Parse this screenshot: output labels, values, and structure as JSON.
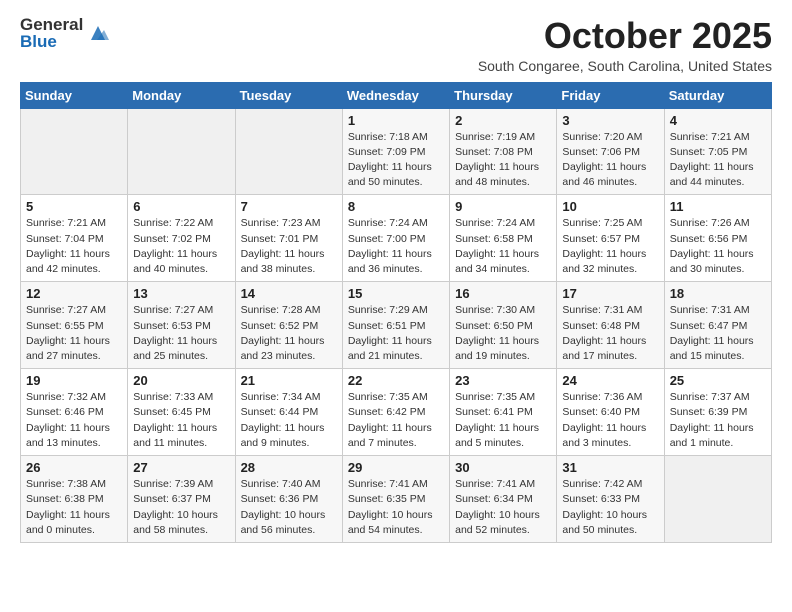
{
  "logo": {
    "general": "General",
    "blue": "Blue"
  },
  "header": {
    "month": "October 2025",
    "location": "South Congaree, South Carolina, United States"
  },
  "days_of_week": [
    "Sunday",
    "Monday",
    "Tuesday",
    "Wednesday",
    "Thursday",
    "Friday",
    "Saturday"
  ],
  "weeks": [
    [
      {
        "day": "",
        "info": ""
      },
      {
        "day": "",
        "info": ""
      },
      {
        "day": "",
        "info": ""
      },
      {
        "day": "1",
        "info": "Sunrise: 7:18 AM\nSunset: 7:09 PM\nDaylight: 11 hours\nand 50 minutes."
      },
      {
        "day": "2",
        "info": "Sunrise: 7:19 AM\nSunset: 7:08 PM\nDaylight: 11 hours\nand 48 minutes."
      },
      {
        "day": "3",
        "info": "Sunrise: 7:20 AM\nSunset: 7:06 PM\nDaylight: 11 hours\nand 46 minutes."
      },
      {
        "day": "4",
        "info": "Sunrise: 7:21 AM\nSunset: 7:05 PM\nDaylight: 11 hours\nand 44 minutes."
      }
    ],
    [
      {
        "day": "5",
        "info": "Sunrise: 7:21 AM\nSunset: 7:04 PM\nDaylight: 11 hours\nand 42 minutes."
      },
      {
        "day": "6",
        "info": "Sunrise: 7:22 AM\nSunset: 7:02 PM\nDaylight: 11 hours\nand 40 minutes."
      },
      {
        "day": "7",
        "info": "Sunrise: 7:23 AM\nSunset: 7:01 PM\nDaylight: 11 hours\nand 38 minutes."
      },
      {
        "day": "8",
        "info": "Sunrise: 7:24 AM\nSunset: 7:00 PM\nDaylight: 11 hours\nand 36 minutes."
      },
      {
        "day": "9",
        "info": "Sunrise: 7:24 AM\nSunset: 6:58 PM\nDaylight: 11 hours\nand 34 minutes."
      },
      {
        "day": "10",
        "info": "Sunrise: 7:25 AM\nSunset: 6:57 PM\nDaylight: 11 hours\nand 32 minutes."
      },
      {
        "day": "11",
        "info": "Sunrise: 7:26 AM\nSunset: 6:56 PM\nDaylight: 11 hours\nand 30 minutes."
      }
    ],
    [
      {
        "day": "12",
        "info": "Sunrise: 7:27 AM\nSunset: 6:55 PM\nDaylight: 11 hours\nand 27 minutes."
      },
      {
        "day": "13",
        "info": "Sunrise: 7:27 AM\nSunset: 6:53 PM\nDaylight: 11 hours\nand 25 minutes."
      },
      {
        "day": "14",
        "info": "Sunrise: 7:28 AM\nSunset: 6:52 PM\nDaylight: 11 hours\nand 23 minutes."
      },
      {
        "day": "15",
        "info": "Sunrise: 7:29 AM\nSunset: 6:51 PM\nDaylight: 11 hours\nand 21 minutes."
      },
      {
        "day": "16",
        "info": "Sunrise: 7:30 AM\nSunset: 6:50 PM\nDaylight: 11 hours\nand 19 minutes."
      },
      {
        "day": "17",
        "info": "Sunrise: 7:31 AM\nSunset: 6:48 PM\nDaylight: 11 hours\nand 17 minutes."
      },
      {
        "day": "18",
        "info": "Sunrise: 7:31 AM\nSunset: 6:47 PM\nDaylight: 11 hours\nand 15 minutes."
      }
    ],
    [
      {
        "day": "19",
        "info": "Sunrise: 7:32 AM\nSunset: 6:46 PM\nDaylight: 11 hours\nand 13 minutes."
      },
      {
        "day": "20",
        "info": "Sunrise: 7:33 AM\nSunset: 6:45 PM\nDaylight: 11 hours\nand 11 minutes."
      },
      {
        "day": "21",
        "info": "Sunrise: 7:34 AM\nSunset: 6:44 PM\nDaylight: 11 hours\nand 9 minutes."
      },
      {
        "day": "22",
        "info": "Sunrise: 7:35 AM\nSunset: 6:42 PM\nDaylight: 11 hours\nand 7 minutes."
      },
      {
        "day": "23",
        "info": "Sunrise: 7:35 AM\nSunset: 6:41 PM\nDaylight: 11 hours\nand 5 minutes."
      },
      {
        "day": "24",
        "info": "Sunrise: 7:36 AM\nSunset: 6:40 PM\nDaylight: 11 hours\nand 3 minutes."
      },
      {
        "day": "25",
        "info": "Sunrise: 7:37 AM\nSunset: 6:39 PM\nDaylight: 11 hours\nand 1 minute."
      }
    ],
    [
      {
        "day": "26",
        "info": "Sunrise: 7:38 AM\nSunset: 6:38 PM\nDaylight: 11 hours\nand 0 minutes."
      },
      {
        "day": "27",
        "info": "Sunrise: 7:39 AM\nSunset: 6:37 PM\nDaylight: 10 hours\nand 58 minutes."
      },
      {
        "day": "28",
        "info": "Sunrise: 7:40 AM\nSunset: 6:36 PM\nDaylight: 10 hours\nand 56 minutes."
      },
      {
        "day": "29",
        "info": "Sunrise: 7:41 AM\nSunset: 6:35 PM\nDaylight: 10 hours\nand 54 minutes."
      },
      {
        "day": "30",
        "info": "Sunrise: 7:41 AM\nSunset: 6:34 PM\nDaylight: 10 hours\nand 52 minutes."
      },
      {
        "day": "31",
        "info": "Sunrise: 7:42 AM\nSunset: 6:33 PM\nDaylight: 10 hours\nand 50 minutes."
      },
      {
        "day": "",
        "info": ""
      }
    ]
  ]
}
